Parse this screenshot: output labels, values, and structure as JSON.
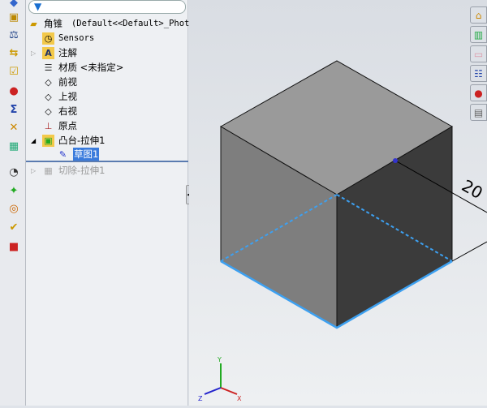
{
  "tree": {
    "root": "角锥",
    "root_config": "(Default<<Default>_Phot",
    "items": [
      "Sensors",
      "注解",
      "材质 <未指定>",
      "前视",
      "上视",
      "右视",
      "原点",
      "凸台-拉伸1",
      "草图1",
      "切除-拉伸1"
    ]
  },
  "viewport": {
    "dimension": "20",
    "triad": {
      "x": "X",
      "y": "Y",
      "z": "Z"
    }
  },
  "colors": {
    "selection": "#3a7bdc",
    "edge_highlight": "#3da0f0"
  }
}
